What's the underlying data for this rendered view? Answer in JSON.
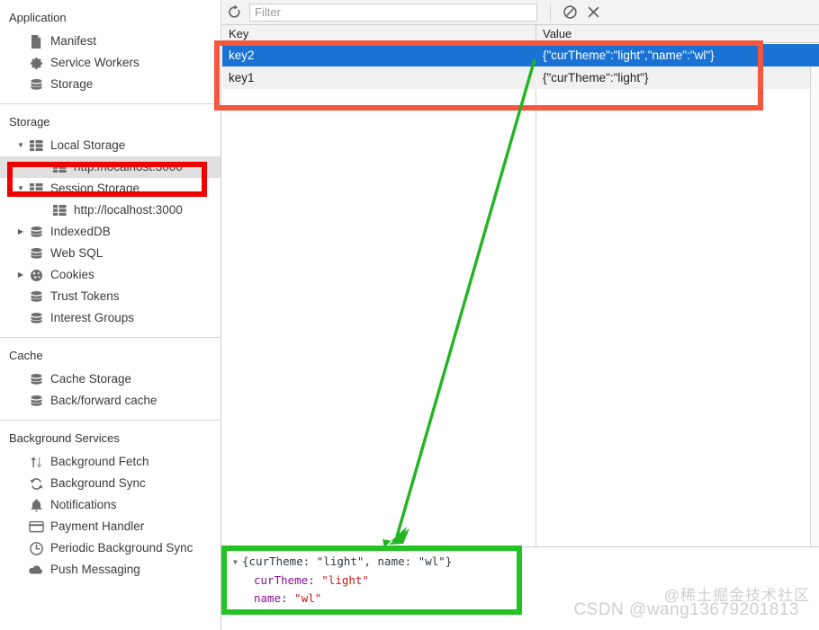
{
  "sidebar": {
    "sections": [
      {
        "title": "Application",
        "items": [
          {
            "label": "Manifest",
            "icon": "document-icon",
            "indent": 1,
            "twisty": "",
            "selected": false
          },
          {
            "label": "Service Workers",
            "icon": "gear-icon",
            "indent": 1,
            "twisty": "",
            "selected": false
          },
          {
            "label": "Storage",
            "icon": "database-icon",
            "indent": 1,
            "twisty": "",
            "selected": false
          }
        ]
      },
      {
        "title": "Storage",
        "items": [
          {
            "label": "Local Storage",
            "icon": "table-icon",
            "indent": 1,
            "twisty": "▼",
            "selected": false
          },
          {
            "label": "http://localhost:3000",
            "icon": "table-icon",
            "indent": 2,
            "twisty": "",
            "selected": true
          },
          {
            "label": "Session Storage",
            "icon": "table-icon",
            "indent": 1,
            "twisty": "▼",
            "selected": false
          },
          {
            "label": "http://localhost:3000",
            "icon": "table-icon",
            "indent": 2,
            "twisty": "",
            "selected": false
          },
          {
            "label": "IndexedDB",
            "icon": "database-icon",
            "indent": 1,
            "twisty": "▶",
            "selected": false
          },
          {
            "label": "Web SQL",
            "icon": "database-icon",
            "indent": 1,
            "twisty": "",
            "selected": false
          },
          {
            "label": "Cookies",
            "icon": "cookie-icon",
            "indent": 1,
            "twisty": "▶",
            "selected": false
          },
          {
            "label": "Trust Tokens",
            "icon": "database-icon",
            "indent": 1,
            "twisty": "",
            "selected": false
          },
          {
            "label": "Interest Groups",
            "icon": "database-icon",
            "indent": 1,
            "twisty": "",
            "selected": false
          }
        ]
      },
      {
        "title": "Cache",
        "items": [
          {
            "label": "Cache Storage",
            "icon": "database-icon",
            "indent": 1,
            "twisty": "",
            "selected": false
          },
          {
            "label": "Back/forward cache",
            "icon": "database-icon",
            "indent": 1,
            "twisty": "",
            "selected": false
          }
        ]
      },
      {
        "title": "Background Services",
        "items": [
          {
            "label": "Background Fetch",
            "icon": "updown-arrows-icon",
            "indent": 1,
            "twisty": "",
            "selected": false
          },
          {
            "label": "Background Sync",
            "icon": "sync-icon",
            "indent": 1,
            "twisty": "",
            "selected": false
          },
          {
            "label": "Notifications",
            "icon": "bell-icon",
            "indent": 1,
            "twisty": "",
            "selected": false
          },
          {
            "label": "Payment Handler",
            "icon": "card-icon",
            "indent": 1,
            "twisty": "",
            "selected": false
          },
          {
            "label": "Periodic Background Sync",
            "icon": "clock-icon",
            "indent": 1,
            "twisty": "",
            "selected": false
          },
          {
            "label": "Push Messaging",
            "icon": "cloud-icon",
            "indent": 1,
            "twisty": "",
            "selected": false
          }
        ]
      }
    ]
  },
  "toolbar": {
    "refresh_icon": "refresh-icon",
    "filter_value": "",
    "filter_placeholder": "Filter",
    "clear_all_icon": "no-entry-icon",
    "delete_selected_icon": "close-x-icon"
  },
  "table": {
    "columns": [
      "Key",
      "Value"
    ],
    "rows": [
      {
        "key": "key2",
        "value": "{\"curTheme\":\"light\",\"name\":\"wl\"}",
        "selected": true
      },
      {
        "key": "key1",
        "value": "{\"curTheme\":\"light\"}",
        "selected": false
      }
    ]
  },
  "preview": {
    "summary_triangle": "▼",
    "summary": "{curTheme: \"light\", name: \"wl\"}",
    "entries": [
      {
        "key": "curTheme",
        "value": "\"light\""
      },
      {
        "key": "name",
        "value": "\"wl\""
      }
    ]
  },
  "watermarks": {
    "juejin": "@稀土掘金技术社区",
    "csdn": "CSDN @wang13679201813"
  },
  "annotations": {
    "red_color": "#f4573f",
    "red_sidebar_color": "#ee0000",
    "green_color": "#24c324"
  }
}
